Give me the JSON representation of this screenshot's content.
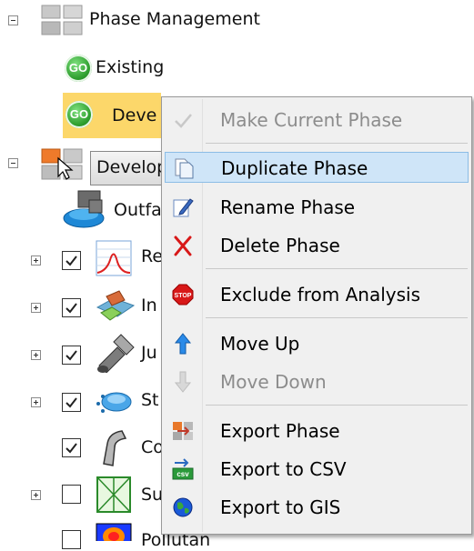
{
  "tree": {
    "root_label": "Phase Management",
    "phases": [
      {
        "label": "Existing",
        "icon": "go-icon"
      },
      {
        "label": "Deve",
        "icon": "go-icon",
        "selected": true
      }
    ],
    "phase_selector_value": "Develop",
    "outfall_label": "Outfa",
    "items": [
      {
        "label": "Re",
        "checked": true,
        "icon": "rainfall-chart-icon"
      },
      {
        "label": "In",
        "checked": true,
        "icon": "inlet-icon"
      },
      {
        "label": "Ju",
        "checked": true,
        "icon": "pipe-junction-icon"
      },
      {
        "label": "St",
        "checked": true,
        "icon": "storage-icon"
      },
      {
        "label": "Co",
        "checked": true,
        "icon": "conduit-icon"
      },
      {
        "label": "Su",
        "checked": false,
        "icon": "subbasin-icon"
      },
      {
        "label": "Pollutan",
        "checked": false,
        "icon": "pollutant-icon"
      }
    ]
  },
  "context_menu": {
    "items": [
      {
        "label": "Make Current Phase",
        "enabled": false,
        "icon": "checkmark-icon"
      },
      {
        "label": "Duplicate Phase",
        "enabled": true,
        "icon": "duplicate-icon",
        "highlighted": true
      },
      {
        "label": "Rename Phase",
        "enabled": true,
        "icon": "rename-icon"
      },
      {
        "label": "Delete Phase",
        "enabled": true,
        "icon": "delete-x-icon"
      },
      {
        "label": "Exclude from Analysis",
        "enabled": true,
        "icon": "stop-sign-icon"
      },
      {
        "label": "Move Up",
        "enabled": true,
        "icon": "arrow-up-icon"
      },
      {
        "label": "Move Down",
        "enabled": false,
        "icon": "arrow-down-icon"
      },
      {
        "label": "Export Phase",
        "enabled": true,
        "icon": "export-icon"
      },
      {
        "label": "Export to CSV",
        "enabled": true,
        "icon": "csv-icon"
      },
      {
        "label": "Export to GIS",
        "enabled": true,
        "icon": "globe-icon"
      }
    ]
  },
  "colors": {
    "selection": "#fcd76a",
    "menu_bg": "#f0f0f0",
    "menu_highlight": "#cfe5f8",
    "disabled_text": "#8c8c8c"
  }
}
